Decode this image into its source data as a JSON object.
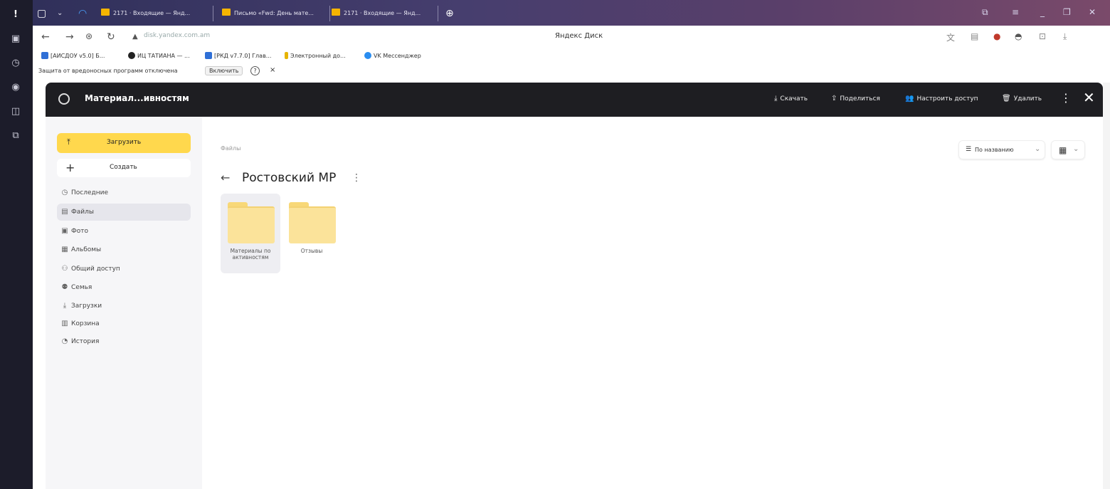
{
  "browser": {
    "tabs": [
      {
        "label": "2171 · Входящие — Янд..."
      },
      {
        "label": "Письмо «Fwd: День мате..."
      },
      {
        "label": "2171 · Входящие — Янд..."
      }
    ],
    "url": "disk.yandex.com.am",
    "page_title": "Яндекс Диск",
    "bookmarks": [
      {
        "label": "[АИСДОУ v5.0] Б..."
      },
      {
        "label": "ИЦ ТАТИАНА — ..."
      },
      {
        "label": "[РКД v7.7.0] Глав..."
      },
      {
        "label": "Электронный до..."
      },
      {
        "label": "VK Мессенджер"
      }
    ],
    "protection_notice": "Защита от вредоносных программ отключена",
    "enable_label": "Включить",
    "help_label": "?",
    "close_label": "×"
  },
  "header": {
    "title": "Материал...ивностям",
    "actions": {
      "download": "Скачать",
      "share": "Поделиться",
      "access": "Настроить доступ",
      "delete": "Удалить"
    }
  },
  "sidebar": {
    "upload_label": "Загрузить",
    "create_label": "Создать",
    "items": [
      {
        "label": "Последние",
        "icon": "clock-icon"
      },
      {
        "label": "Файлы",
        "icon": "file-icon",
        "active": true
      },
      {
        "label": "Фото",
        "icon": "photo-icon"
      },
      {
        "label": "Альбомы",
        "icon": "album-icon"
      },
      {
        "label": "Общий доступ",
        "icon": "shared-icon"
      },
      {
        "label": "Семья",
        "icon": "family-icon"
      },
      {
        "label": "Загрузки",
        "icon": "download-icon"
      },
      {
        "label": "Корзина",
        "icon": "trash-icon"
      },
      {
        "label": "История",
        "icon": "history-icon"
      }
    ]
  },
  "main": {
    "breadcrumb": "Файлы",
    "folder_title": "Ростовский МР",
    "sort_label": "По названию",
    "files": [
      {
        "name": "Материалы по активностям",
        "selected": true
      },
      {
        "name": "Отзывы",
        "selected": false
      }
    ]
  },
  "colors": {
    "accent": "#ffd84d",
    "header_bg": "#1e1e22",
    "folder": "#fbe39a"
  }
}
